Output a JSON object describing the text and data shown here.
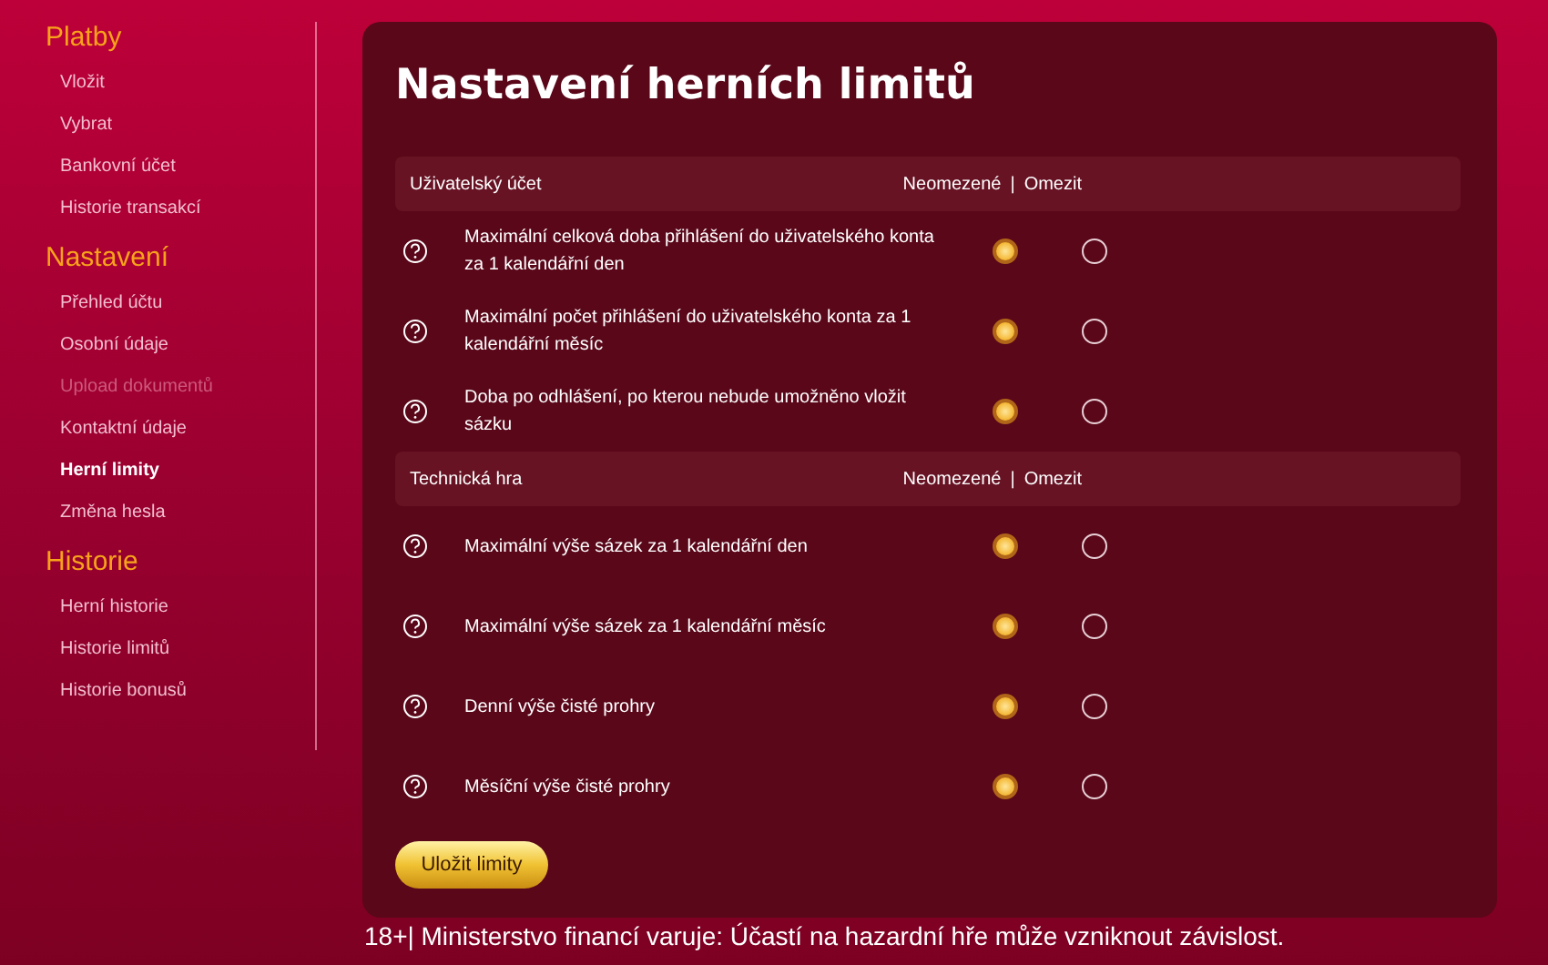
{
  "sidebar": {
    "groups": [
      {
        "title": "Platby",
        "items": [
          {
            "label": "Vložit",
            "selected": false,
            "disabled": false
          },
          {
            "label": "Vybrat",
            "selected": false,
            "disabled": false
          },
          {
            "label": "Bankovní účet",
            "selected": false,
            "disabled": false
          },
          {
            "label": "Historie transakcí",
            "selected": false,
            "disabled": false
          }
        ]
      },
      {
        "title": "Nastavení",
        "items": [
          {
            "label": "Přehled účtu",
            "selected": false,
            "disabled": false
          },
          {
            "label": "Osobní údaje",
            "selected": false,
            "disabled": false
          },
          {
            "label": "Upload dokumentů",
            "selected": false,
            "disabled": true
          },
          {
            "label": "Kontaktní údaje",
            "selected": false,
            "disabled": false
          },
          {
            "label": "Herní limity",
            "selected": true,
            "disabled": false
          },
          {
            "label": "Změna hesla",
            "selected": false,
            "disabled": false
          }
        ]
      },
      {
        "title": "Historie",
        "items": [
          {
            "label": "Herní historie",
            "selected": false,
            "disabled": false
          },
          {
            "label": "Historie limitů",
            "selected": false,
            "disabled": false
          },
          {
            "label": "Historie bonusů",
            "selected": false,
            "disabled": false
          }
        ]
      }
    ]
  },
  "panel": {
    "title": "Nastavení herních limitů",
    "sections": [
      {
        "title": "Uživatelský účet",
        "option_labels": [
          "Neomezené",
          "|",
          "Omezit"
        ],
        "rows": [
          {
            "label": "Maximální celková doba přihlášení do uživatelského konta za 1 kalendářní den",
            "options": [
              {
                "selected": true
              },
              {
                "selected": false
              }
            ]
          },
          {
            "label": "Maximální počet přihlášení do uživatelského konta za 1 kalendářní měsíc",
            "options": [
              {
                "selected": true
              },
              {
                "selected": false
              }
            ]
          },
          {
            "label": "Doba po odhlášení, po kterou nebude umožněno vložit sázku",
            "options": [
              {
                "selected": true
              },
              {
                "selected": false
              }
            ]
          }
        ]
      },
      {
        "title": "Technická hra",
        "option_labels": [
          "Neomezené",
          "|",
          "Omezit"
        ],
        "rows": [
          {
            "label": "Maximální výše sázek za 1 kalendářní den",
            "options": [
              {
                "selected": true
              },
              {
                "selected": false
              }
            ]
          },
          {
            "label": "Maximální výše sázek za 1 kalendářní měsíc",
            "options": [
              {
                "selected": true
              },
              {
                "selected": false
              }
            ]
          },
          {
            "label": "Denní výše čisté prohry",
            "options": [
              {
                "selected": true
              },
              {
                "selected": false
              }
            ]
          },
          {
            "label": "Měsíční výše čisté prohry",
            "options": [
              {
                "selected": true
              },
              {
                "selected": false
              }
            ]
          }
        ]
      }
    ],
    "save_button": "Uložit limity"
  },
  "footer": "18+| Ministerstvo financí varuje: Účastí na hazardní hře může vzniknout závislost."
}
